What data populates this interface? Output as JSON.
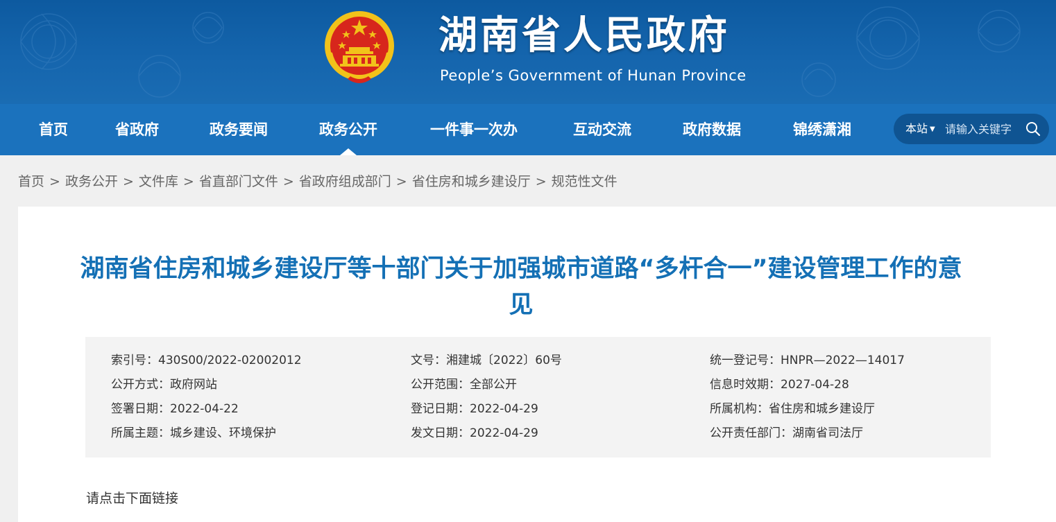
{
  "header": {
    "title": "湖南省人民政府",
    "subtitle": "People’s Government of Hunan Province"
  },
  "nav": {
    "items": [
      "首页",
      "省政府",
      "政务要闻",
      "政务公开",
      "一件事一次办",
      "互动交流",
      "政府数据",
      "锦绣潇湘"
    ],
    "active": "政务公开"
  },
  "search": {
    "scope": "本站",
    "placeholder": "请输入关键字"
  },
  "breadcrumb": [
    "首页",
    "政务公开",
    "文件库",
    "省直部门文件",
    "省政府组成部门",
    "省住房和城乡建设厅",
    "规范性文件"
  ],
  "article": {
    "title": "湖南省住房和城乡建设厅等十部门关于加强城市道路“多杆合一”建设管理工作的意见",
    "meta": [
      [
        "索引号：430S00/2022-02002012",
        "文号：湘建城〔2022〕60号",
        "统一登记号：HNPR—2022—14017"
      ],
      [
        "公开方式：政府网站",
        "公开范围：全部公开",
        "信息时效期：2027-04-28"
      ],
      [
        "签署日期：2022-04-22",
        "登记日期：2022-04-29",
        "所属机构：省住房和城乡建设厅"
      ],
      [
        "所属主题：城乡建设、环境保护",
        "发文日期：2022-04-29",
        "公开责任部门：湖南省司法厅"
      ]
    ],
    "link_hint": "请点击下面链接"
  },
  "colors": {
    "banner": "#1565ad",
    "navbar": "#1b72bd",
    "search_bg": "#0f5492",
    "title": "#1470b5",
    "emblem_red": "#d7261c",
    "emblem_gold": "#f2c21a"
  },
  "icons": [
    "national-emblem-icon",
    "search-icon",
    "dropdown-arrow-icon"
  ]
}
